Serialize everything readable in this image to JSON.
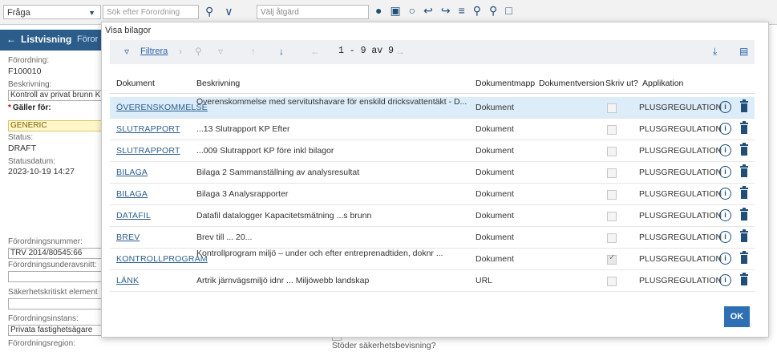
{
  "colors": {
    "accent": "#2b5c8a",
    "link": "#2c5f8e",
    "selected_row": "#dcecf8",
    "ok_button": "#2f6fb3"
  },
  "topbar": {
    "query_select": "Fråga",
    "search_placeholder": "Sök efter Förordning",
    "action_placeholder": "Välj åtgärd",
    "icons": [
      "search-icon",
      "collapse-icon",
      "info-icon",
      "save-icon",
      "refresh-icon",
      "undo-icon",
      "redo-icon",
      "tree-icon",
      "zoom-icon",
      "zoom-icon",
      "document-icon"
    ]
  },
  "subbar": {
    "back_label": "Listvisning",
    "tab_label": "Föror"
  },
  "form": {
    "forordning_label": "Förordning:",
    "forordning_value": "F100010",
    "beskrivning_label": "Beskrivning:",
    "beskrivning_value": "Kontroll av privat brunn K",
    "galler_for_label": "Gäller för:",
    "galler_for_value": "GENERIC",
    "status_label": "Status:",
    "status_value": "DRAFT",
    "statusdatum_label": "Statusdatum:",
    "statusdatum_value": "2023-10-19 14:27",
    "nummer_label": "Förordningsnummer:",
    "nummer_value": "TRV 2014/80545:66",
    "underavsnitt_label": "Förordningsunderavsnitt:",
    "underavsnitt_value": "",
    "sakerhet_label": "Säkerhetskritiskt element",
    "sakerhet_value": "",
    "instans_label": "Förordningsinstans:",
    "instans_value": "Privata fastighetsägare",
    "region_label": "Förordningsregion:"
  },
  "background": {
    "checkbox_label": "Stöder säkerhetsbevisning?"
  },
  "dialog": {
    "title": "Visa bilagor",
    "filter_label": "Filtrera",
    "range_text": "1 - 9 av 9",
    "columns": {
      "dokument": "Dokument",
      "beskrivning": "Beskrivning",
      "dokumentmapp": "Dokumentmapp",
      "dokumentversion": "Dokumentversion",
      "skriv_ut": "Skriv ut?",
      "applikation": "Applikation"
    },
    "rows": [
      {
        "dokument": "ÖVERENSKOMMELSE",
        "beskrivning": "Överenskommelse med servitutshavare för enskild dricksvattentäkt - D...",
        "mapp": "Dokument",
        "skriv_ut": false,
        "applikation": "PLUSGREGULATION",
        "selected": true
      },
      {
        "dokument": "SLUTRAPPORT",
        "beskrivning": "...13 Slutrapport KP Efter",
        "mapp": "Dokument",
        "skriv_ut": false,
        "applikation": "PLUSGREGULATION",
        "selected": false
      },
      {
        "dokument": "SLUTRAPPORT",
        "beskrivning": "...009 Slutrapport KP före inkl bilagor",
        "mapp": "Dokument",
        "skriv_ut": false,
        "applikation": "PLUSGREGULATION",
        "selected": false
      },
      {
        "dokument": "BILAGA",
        "beskrivning": "Bilaga 2 Sammanställning av analysresultat",
        "mapp": "Dokument",
        "skriv_ut": false,
        "applikation": "PLUSGREGULATION",
        "selected": false
      },
      {
        "dokument": "BILAGA",
        "beskrivning": "Bilaga 3 Analysrapporter",
        "mapp": "Dokument",
        "skriv_ut": false,
        "applikation": "PLUSGREGULATION",
        "selected": false
      },
      {
        "dokument": "DATAFIL",
        "beskrivning": "Datafil datalogger Kapacitetsmätning ...s brunn",
        "mapp": "Dokument",
        "skriv_ut": false,
        "applikation": "PLUSGREGULATION",
        "selected": false
      },
      {
        "dokument": "BREV",
        "beskrivning": "Brev till ... 20...",
        "mapp": "Dokument",
        "skriv_ut": false,
        "applikation": "PLUSGREGULATION",
        "selected": false
      },
      {
        "dokument": "KONTROLLPROGRAM",
        "beskrivning": "Kontrollprogram miljö – under och efter entreprenadtiden, doknr ...",
        "mapp": "Dokument",
        "skriv_ut": true,
        "applikation": "PLUSGREGULATION",
        "selected": false
      },
      {
        "dokument": "LÄNK",
        "beskrivning": "Artrik järnvägsmiljö idnr ... Miljöwebb landskap",
        "mapp": "URL",
        "skriv_ut": false,
        "applikation": "PLUSGREGULATION",
        "selected": false
      }
    ],
    "ok_label": "OK"
  }
}
